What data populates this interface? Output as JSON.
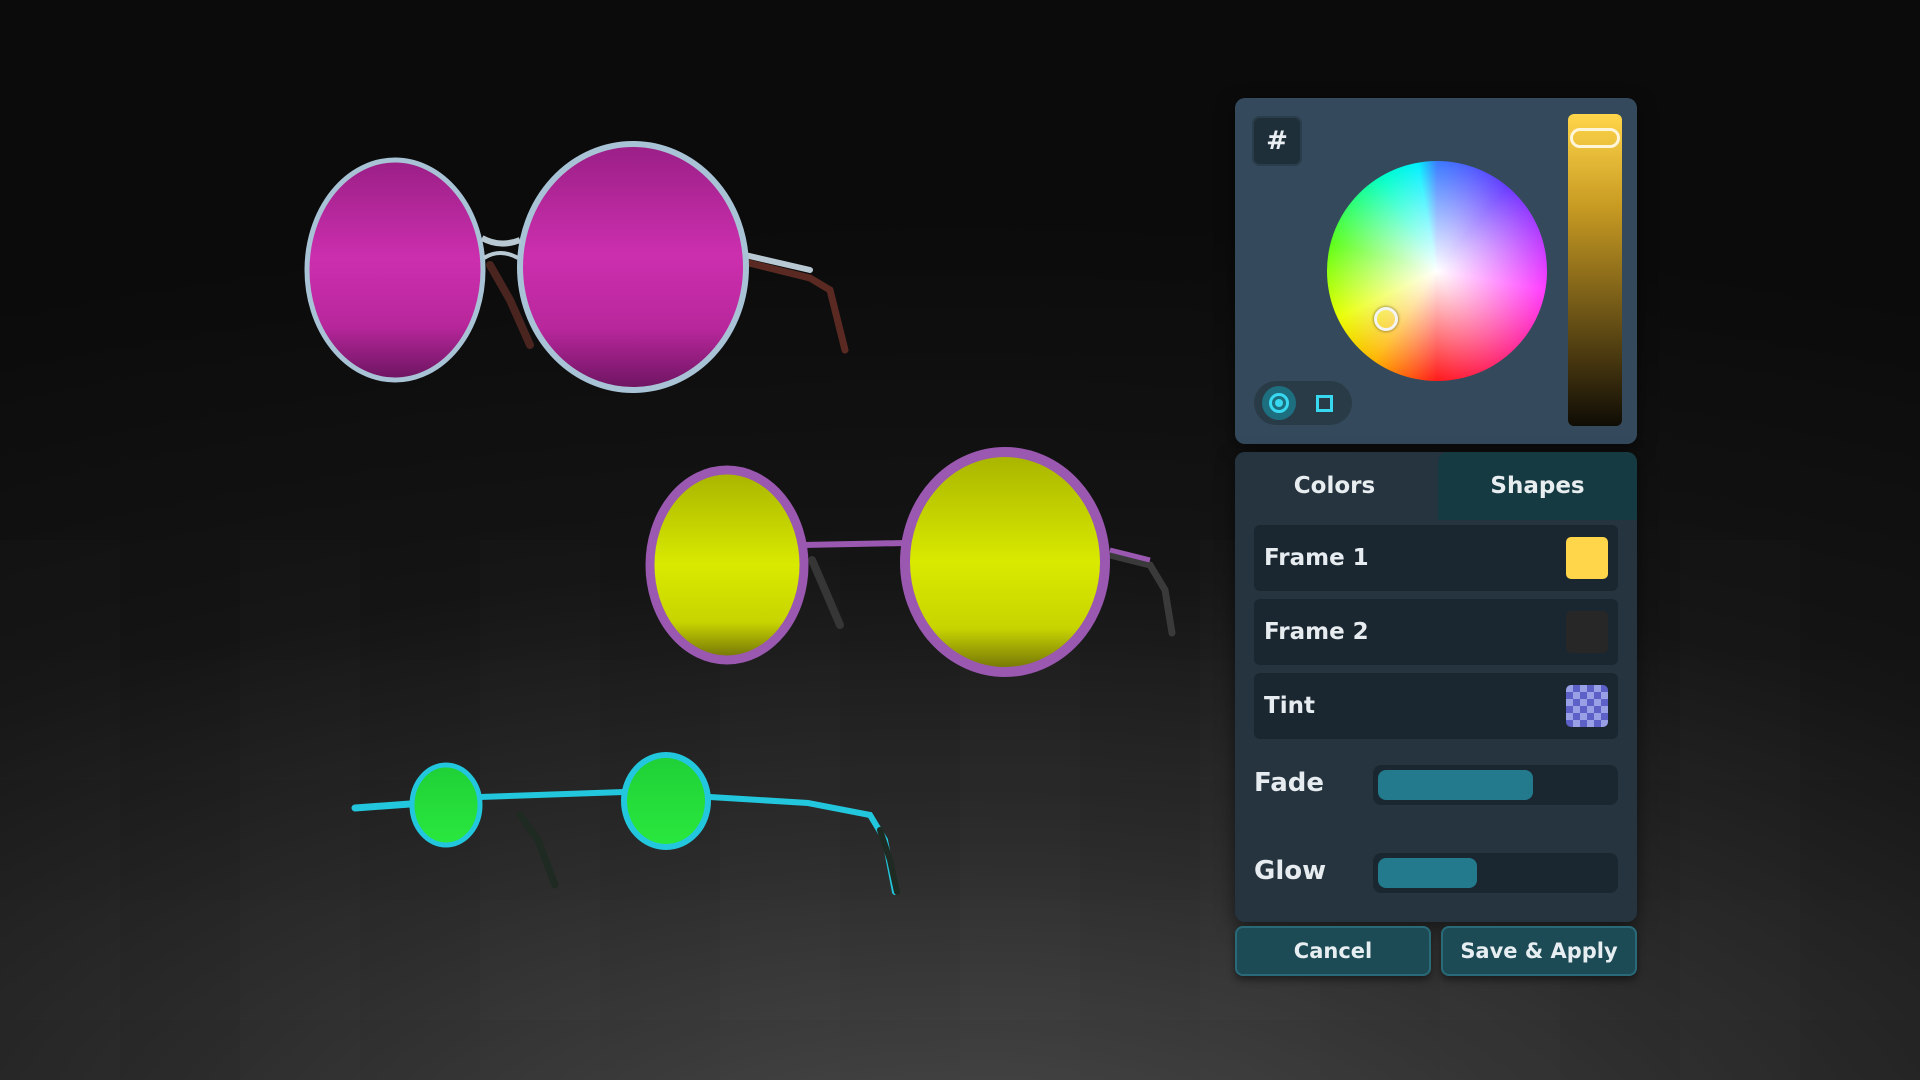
{
  "picker": {
    "hex_button_label": "#",
    "wheel_knob_hue": "yellow",
    "brightness_color": "#ffd54a",
    "shape_modes": [
      "circle",
      "square"
    ],
    "active_shape_mode": "circle"
  },
  "tabs": [
    {
      "label": "Colors",
      "active": true
    },
    {
      "label": "Shapes",
      "active": false
    }
  ],
  "color_slots": [
    {
      "label": "Frame 1",
      "swatch": "#ffd54a"
    },
    {
      "label": "Frame 2",
      "swatch": "#272727"
    },
    {
      "label": "Tint",
      "swatch": "checker"
    }
  ],
  "sliders": [
    {
      "label": "Fade",
      "value": 0.66
    },
    {
      "label": "Glow",
      "value": 0.42
    }
  ],
  "actions": {
    "cancel_label": "Cancel",
    "save_label": "Save & Apply"
  },
  "scene": {
    "glasses": [
      {
        "lens_color": "#c62aa8",
        "frame_color": "#a9c3d6"
      },
      {
        "lens_color": "#d8e600",
        "frame_color": "#9a58b0"
      },
      {
        "lens_color": "#22e03a",
        "frame_color": "#22c7dd"
      }
    ]
  }
}
